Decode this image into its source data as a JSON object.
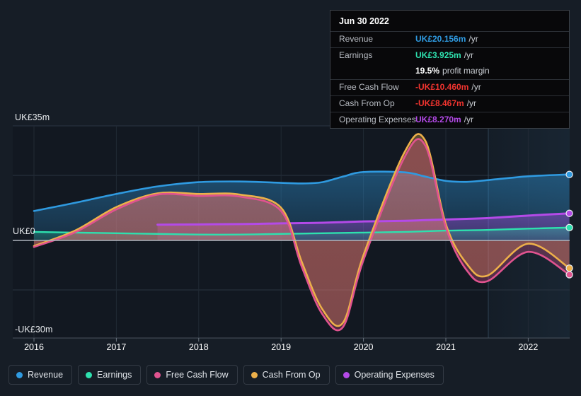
{
  "chart_data": {
    "type": "line",
    "title": "",
    "xlabel": "",
    "ylabel": "",
    "currency": "UK£",
    "unit": "m",
    "ylim": [
      -30,
      35
    ],
    "y_ticks": [
      {
        "value": 35,
        "label": "UK£35m"
      },
      {
        "value": 0,
        "label": "UK£0"
      },
      {
        "value": -30,
        "label": "-UK£30m"
      }
    ],
    "grid": true,
    "legend_position": "bottom",
    "x_ticks": [
      "2016",
      "2017",
      "2018",
      "2019",
      "2020",
      "2021",
      "2022"
    ],
    "x": [
      2016.0,
      2016.5,
      2017.0,
      2017.5,
      2018.0,
      2018.5,
      2019.0,
      2019.25,
      2019.5,
      2019.75,
      2020.0,
      2020.5,
      2020.75,
      2021.0,
      2021.25,
      2021.5,
      2022.0,
      2022.5
    ],
    "series": [
      {
        "name": "Revenue",
        "color": "#2f9ae0",
        "values": [
          9.0,
          11.5,
          14.2,
          16.5,
          17.8,
          18.0,
          17.6,
          17.4,
          17.8,
          19.5,
          20.9,
          20.8,
          19.5,
          18.2,
          17.9,
          18.4,
          19.6,
          20.156
        ]
      },
      {
        "name": "Earnings",
        "color": "#2ee0ae",
        "values": [
          2.6,
          2.4,
          2.2,
          2.0,
          1.8,
          1.8,
          2.0,
          2.1,
          2.2,
          2.3,
          2.4,
          2.6,
          2.8,
          3.0,
          3.1,
          3.2,
          3.6,
          3.925
        ]
      },
      {
        "name": "Free Cash Flow",
        "color": "#e0538f",
        "values": [
          -2.0,
          2.5,
          9.5,
          14.0,
          13.6,
          13.4,
          9.0,
          -8.0,
          -22.5,
          -26.5,
          -6.0,
          25.5,
          29.0,
          4.0,
          -9.0,
          -12.5,
          -3.5,
          -10.46
        ]
      },
      {
        "name": "Cash From Op",
        "color": "#edb04a",
        "values": [
          -1.7,
          3.0,
          10.2,
          14.4,
          14.2,
          14.0,
          10.0,
          -6.5,
          -21.0,
          -25.2,
          -4.5,
          27.0,
          30.5,
          5.0,
          -7.0,
          -10.8,
          -1.0,
          -8.467
        ]
      },
      {
        "name": "Operating Expenses",
        "color": "#b44ae8",
        "values": [
          null,
          null,
          null,
          4.8,
          4.9,
          5.0,
          5.2,
          5.3,
          5.4,
          5.6,
          5.8,
          6.0,
          6.2,
          6.4,
          6.6,
          6.8,
          7.6,
          8.27
        ]
      }
    ]
  },
  "tooltip": {
    "date": "Jun 30 2022",
    "rows": [
      {
        "key": "Revenue",
        "value": "UK£20.156m",
        "unit": "/yr",
        "color": "revenue"
      },
      {
        "key": "Earnings",
        "value": "UK£3.925m",
        "unit": "/yr",
        "color": "earnings"
      },
      {
        "key": "",
        "value": "19.5%",
        "unit": "profit margin",
        "color": "white"
      },
      {
        "key": "Free Cash Flow",
        "value": "-UK£10.460m",
        "unit": "/yr",
        "color": "negative"
      },
      {
        "key": "Cash From Op",
        "value": "-UK£8.467m",
        "unit": "/yr",
        "color": "negative"
      },
      {
        "key": "Operating Expenses",
        "value": "UK£8.270m",
        "unit": "/yr",
        "color": "opex"
      }
    ]
  },
  "legend": {
    "items": [
      {
        "label": "Revenue",
        "color": "#2f9ae0"
      },
      {
        "label": "Earnings",
        "color": "#2ee0ae"
      },
      {
        "label": "Free Cash Flow",
        "color": "#e0538f"
      },
      {
        "label": "Cash From Op",
        "color": "#edb04a"
      },
      {
        "label": "Operating Expenses",
        "color": "#b44ae8"
      }
    ]
  },
  "axis": {
    "y_top": "UK£35m",
    "y_zero": "UK£0",
    "y_bottom": "-UK£30m"
  },
  "colors": {
    "background": "#161d26",
    "grid": "#2a3441",
    "zero_line": "#aeb4bd",
    "tooltip_bg": "#08080a"
  }
}
